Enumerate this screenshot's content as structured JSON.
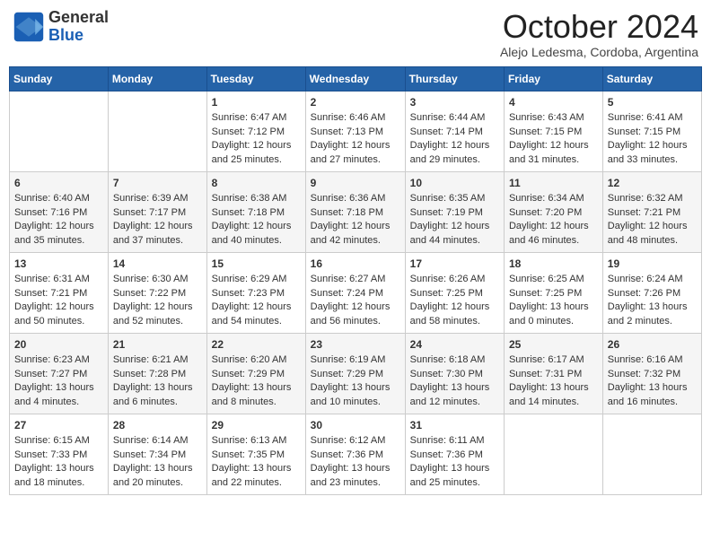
{
  "logo": {
    "text_general": "General",
    "text_blue": "Blue"
  },
  "header": {
    "title": "October 2024",
    "subtitle": "Alejo Ledesma, Cordoba, Argentina"
  },
  "days_of_week": [
    "Sunday",
    "Monday",
    "Tuesday",
    "Wednesday",
    "Thursday",
    "Friday",
    "Saturday"
  ],
  "weeks": [
    [
      {
        "day": "",
        "info": ""
      },
      {
        "day": "",
        "info": ""
      },
      {
        "day": "1",
        "info": "Sunrise: 6:47 AM\nSunset: 7:12 PM\nDaylight: 12 hours and 25 minutes."
      },
      {
        "day": "2",
        "info": "Sunrise: 6:46 AM\nSunset: 7:13 PM\nDaylight: 12 hours and 27 minutes."
      },
      {
        "day": "3",
        "info": "Sunrise: 6:44 AM\nSunset: 7:14 PM\nDaylight: 12 hours and 29 minutes."
      },
      {
        "day": "4",
        "info": "Sunrise: 6:43 AM\nSunset: 7:15 PM\nDaylight: 12 hours and 31 minutes."
      },
      {
        "day": "5",
        "info": "Sunrise: 6:41 AM\nSunset: 7:15 PM\nDaylight: 12 hours and 33 minutes."
      }
    ],
    [
      {
        "day": "6",
        "info": "Sunrise: 6:40 AM\nSunset: 7:16 PM\nDaylight: 12 hours and 35 minutes."
      },
      {
        "day": "7",
        "info": "Sunrise: 6:39 AM\nSunset: 7:17 PM\nDaylight: 12 hours and 37 minutes."
      },
      {
        "day": "8",
        "info": "Sunrise: 6:38 AM\nSunset: 7:18 PM\nDaylight: 12 hours and 40 minutes."
      },
      {
        "day": "9",
        "info": "Sunrise: 6:36 AM\nSunset: 7:18 PM\nDaylight: 12 hours and 42 minutes."
      },
      {
        "day": "10",
        "info": "Sunrise: 6:35 AM\nSunset: 7:19 PM\nDaylight: 12 hours and 44 minutes."
      },
      {
        "day": "11",
        "info": "Sunrise: 6:34 AM\nSunset: 7:20 PM\nDaylight: 12 hours and 46 minutes."
      },
      {
        "day": "12",
        "info": "Sunrise: 6:32 AM\nSunset: 7:21 PM\nDaylight: 12 hours and 48 minutes."
      }
    ],
    [
      {
        "day": "13",
        "info": "Sunrise: 6:31 AM\nSunset: 7:21 PM\nDaylight: 12 hours and 50 minutes."
      },
      {
        "day": "14",
        "info": "Sunrise: 6:30 AM\nSunset: 7:22 PM\nDaylight: 12 hours and 52 minutes."
      },
      {
        "day": "15",
        "info": "Sunrise: 6:29 AM\nSunset: 7:23 PM\nDaylight: 12 hours and 54 minutes."
      },
      {
        "day": "16",
        "info": "Sunrise: 6:27 AM\nSunset: 7:24 PM\nDaylight: 12 hours and 56 minutes."
      },
      {
        "day": "17",
        "info": "Sunrise: 6:26 AM\nSunset: 7:25 PM\nDaylight: 12 hours and 58 minutes."
      },
      {
        "day": "18",
        "info": "Sunrise: 6:25 AM\nSunset: 7:25 PM\nDaylight: 13 hours and 0 minutes."
      },
      {
        "day": "19",
        "info": "Sunrise: 6:24 AM\nSunset: 7:26 PM\nDaylight: 13 hours and 2 minutes."
      }
    ],
    [
      {
        "day": "20",
        "info": "Sunrise: 6:23 AM\nSunset: 7:27 PM\nDaylight: 13 hours and 4 minutes."
      },
      {
        "day": "21",
        "info": "Sunrise: 6:21 AM\nSunset: 7:28 PM\nDaylight: 13 hours and 6 minutes."
      },
      {
        "day": "22",
        "info": "Sunrise: 6:20 AM\nSunset: 7:29 PM\nDaylight: 13 hours and 8 minutes."
      },
      {
        "day": "23",
        "info": "Sunrise: 6:19 AM\nSunset: 7:29 PM\nDaylight: 13 hours and 10 minutes."
      },
      {
        "day": "24",
        "info": "Sunrise: 6:18 AM\nSunset: 7:30 PM\nDaylight: 13 hours and 12 minutes."
      },
      {
        "day": "25",
        "info": "Sunrise: 6:17 AM\nSunset: 7:31 PM\nDaylight: 13 hours and 14 minutes."
      },
      {
        "day": "26",
        "info": "Sunrise: 6:16 AM\nSunset: 7:32 PM\nDaylight: 13 hours and 16 minutes."
      }
    ],
    [
      {
        "day": "27",
        "info": "Sunrise: 6:15 AM\nSunset: 7:33 PM\nDaylight: 13 hours and 18 minutes."
      },
      {
        "day": "28",
        "info": "Sunrise: 6:14 AM\nSunset: 7:34 PM\nDaylight: 13 hours and 20 minutes."
      },
      {
        "day": "29",
        "info": "Sunrise: 6:13 AM\nSunset: 7:35 PM\nDaylight: 13 hours and 22 minutes."
      },
      {
        "day": "30",
        "info": "Sunrise: 6:12 AM\nSunset: 7:36 PM\nDaylight: 13 hours and 23 minutes."
      },
      {
        "day": "31",
        "info": "Sunrise: 6:11 AM\nSunset: 7:36 PM\nDaylight: 13 hours and 25 minutes."
      },
      {
        "day": "",
        "info": ""
      },
      {
        "day": "",
        "info": ""
      }
    ]
  ]
}
